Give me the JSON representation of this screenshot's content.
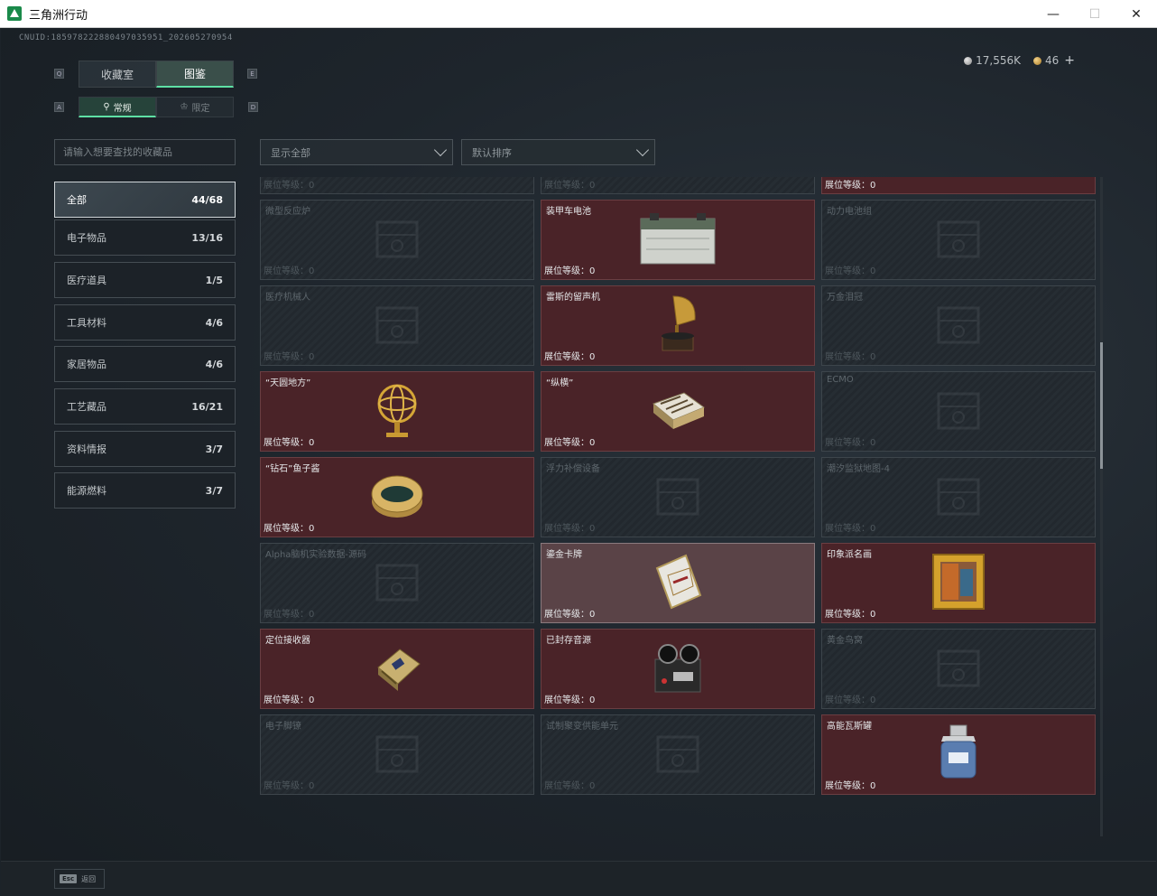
{
  "window": {
    "title": "三角洲行动",
    "minimize": "—",
    "maximize": "☐",
    "close": "✕"
  },
  "header": {
    "uid": "CNUID:18597822288049703595‌1_202605270954",
    "silver_amount": "17,556K",
    "gold_amount": "46",
    "plus": "+"
  },
  "tabs": {
    "collection": "收藏室",
    "catalog": "图鉴"
  },
  "subtabs": {
    "normal": "常规",
    "limited": "限定"
  },
  "key_hints": {
    "tab_left": "Q",
    "tab_right": "E",
    "sub_left": "A",
    "sub_right": "D"
  },
  "search": {
    "placeholder": "请输入想要查找的收藏品"
  },
  "filters": {
    "show": "显示全部",
    "sort": "默认排序"
  },
  "categories": [
    {
      "label": "全部",
      "count": "44/68"
    },
    {
      "label": "电子物品",
      "count": "13/16"
    },
    {
      "label": "医疗道具",
      "count": "1/5"
    },
    {
      "label": "工具材料",
      "count": "4/6"
    },
    {
      "label": "家居物品",
      "count": "4/6"
    },
    {
      "label": "工艺藏品",
      "count": "16/21"
    },
    {
      "label": "资料情报",
      "count": "3/7"
    },
    {
      "label": "能源燃料",
      "count": "3/7"
    }
  ],
  "level_label": "展位等级：0",
  "items": [
    {
      "name": "",
      "icon": "crate-icon"
    },
    {
      "name": "",
      "icon": "machine-icon"
    },
    {
      "name": "",
      "icon": "coffee-bag-icon"
    },
    {
      "name": "微型反应炉",
      "icon": "reactor-icon"
    },
    {
      "name": "装甲车电池",
      "icon": "battery-icon"
    },
    {
      "name": "动力电池组",
      "icon": "power-cell-icon"
    },
    {
      "name": "医疗机械人",
      "icon": "robot-icon"
    },
    {
      "name": "雷斯的留声机",
      "icon": "gramophone-icon"
    },
    {
      "name": "万金泪冠",
      "icon": "crown-icon"
    },
    {
      "name": "“天圆地方”",
      "icon": "armillary-icon"
    },
    {
      "name": "“纵横”",
      "icon": "chess-box-icon"
    },
    {
      "name": "ECMO",
      "icon": "ecmo-icon"
    },
    {
      "name": "“钻石”鱼子酱",
      "icon": "caviar-tin-icon"
    },
    {
      "name": "浮力补偿设备",
      "icon": "buoyancy-icon"
    },
    {
      "name": "潮汐监狱地图-4",
      "icon": "map-icon"
    },
    {
      "name": "Alpha脑机实验数据-源码",
      "icon": "data-drive-icon"
    },
    {
      "name": "鎏金卡牌",
      "icon": "gold-card-icon"
    },
    {
      "name": "印象派名画",
      "icon": "painting-icon"
    },
    {
      "name": "定位接收器",
      "icon": "receiver-icon"
    },
    {
      "name": "已封存音源",
      "icon": "tape-recorder-icon"
    },
    {
      "name": "黄金鸟窝",
      "icon": "golden-nest-icon"
    },
    {
      "name": "电子脚镣",
      "icon": "ankle-monitor-icon"
    },
    {
      "name": "试制聚变供能单元",
      "icon": "fusion-cell-icon"
    },
    {
      "name": "高能瓦斯罐",
      "icon": "gas-canister-icon"
    }
  ],
  "footer": {
    "esc_key": "Esc",
    "esc_label": "返回"
  },
  "colors": {
    "accent": "#5ee0a5",
    "owned_card": "#4a2328",
    "locked_card": "#262d33"
  }
}
